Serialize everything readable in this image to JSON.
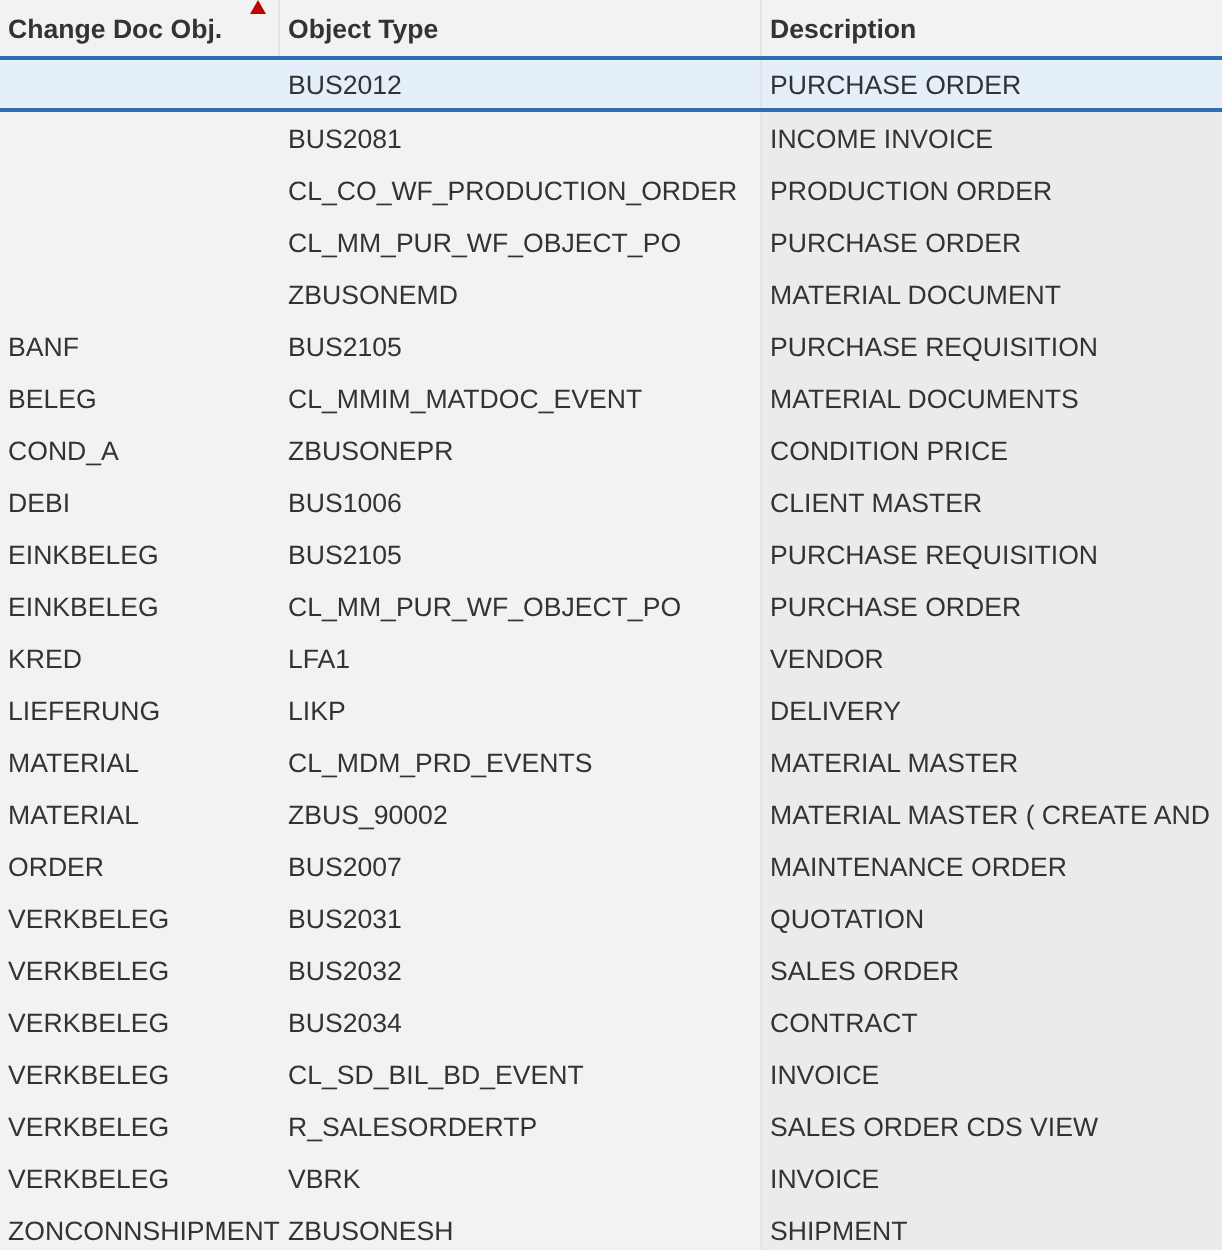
{
  "table": {
    "columns": [
      {
        "label": "Change Doc Obj.",
        "sorted": true
      },
      {
        "label": "Object Type",
        "sorted": false
      },
      {
        "label": "Description",
        "sorted": false
      }
    ],
    "rows": [
      {
        "cells": [
          "",
          "BUS2012",
          "PURCHASE ORDER"
        ],
        "selected": true
      },
      {
        "cells": [
          "",
          "BUS2081",
          "INCOME INVOICE"
        ],
        "selected": false
      },
      {
        "cells": [
          "",
          "CL_CO_WF_PRODUCTION_ORDER",
          "PRODUCTION ORDER"
        ],
        "selected": false
      },
      {
        "cells": [
          "",
          "CL_MM_PUR_WF_OBJECT_PO",
          "PURCHASE ORDER"
        ],
        "selected": false
      },
      {
        "cells": [
          "",
          "ZBUSONEMD",
          "MATERIAL DOCUMENT"
        ],
        "selected": false
      },
      {
        "cells": [
          "BANF",
          "BUS2105",
          "PURCHASE REQUISITION"
        ],
        "selected": false
      },
      {
        "cells": [
          "BELEG",
          "CL_MMIM_MATDOC_EVENT",
          "MATERIAL DOCUMENTS"
        ],
        "selected": false
      },
      {
        "cells": [
          "COND_A",
          "ZBUSONEPR",
          "CONDITION PRICE"
        ],
        "selected": false
      },
      {
        "cells": [
          "DEBI",
          "BUS1006",
          "CLIENT MASTER"
        ],
        "selected": false
      },
      {
        "cells": [
          "EINKBELEG",
          "BUS2105",
          "PURCHASE REQUISITION"
        ],
        "selected": false
      },
      {
        "cells": [
          "EINKBELEG",
          "CL_MM_PUR_WF_OBJECT_PO",
          "PURCHASE ORDER"
        ],
        "selected": false
      },
      {
        "cells": [
          "KRED",
          "LFA1",
          "VENDOR"
        ],
        "selected": false
      },
      {
        "cells": [
          "LIEFERUNG",
          "LIKP",
          "DELIVERY"
        ],
        "selected": false
      },
      {
        "cells": [
          "MATERIAL",
          "CL_MDM_PRD_EVENTS",
          "MATERIAL MASTER"
        ],
        "selected": false
      },
      {
        "cells": [
          "MATERIAL",
          "ZBUS_90002",
          "MATERIAL MASTER ( CREATE AND"
        ],
        "selected": false
      },
      {
        "cells": [
          "ORDER",
          "BUS2007",
          "MAINTENANCE ORDER"
        ],
        "selected": false
      },
      {
        "cells": [
          "VERKBELEG",
          "BUS2031",
          "QUOTATION"
        ],
        "selected": false
      },
      {
        "cells": [
          "VERKBELEG",
          "BUS2032",
          "SALES ORDER"
        ],
        "selected": false
      },
      {
        "cells": [
          "VERKBELEG",
          "BUS2034",
          "CONTRACT"
        ],
        "selected": false
      },
      {
        "cells": [
          "VERKBELEG",
          "CL_SD_BIL_BD_EVENT",
          "INVOICE"
        ],
        "selected": false
      },
      {
        "cells": [
          "VERKBELEG",
          "R_SALESORDERTP",
          "SALES ORDER CDS VIEW"
        ],
        "selected": false
      },
      {
        "cells": [
          "VERKBELEG",
          "VBRK",
          "INVOICE"
        ],
        "selected": false
      },
      {
        "cells": [
          "ZONCONNSHIPMENT",
          "ZBUSONESH",
          "SHIPMENT"
        ],
        "selected": false
      }
    ]
  }
}
